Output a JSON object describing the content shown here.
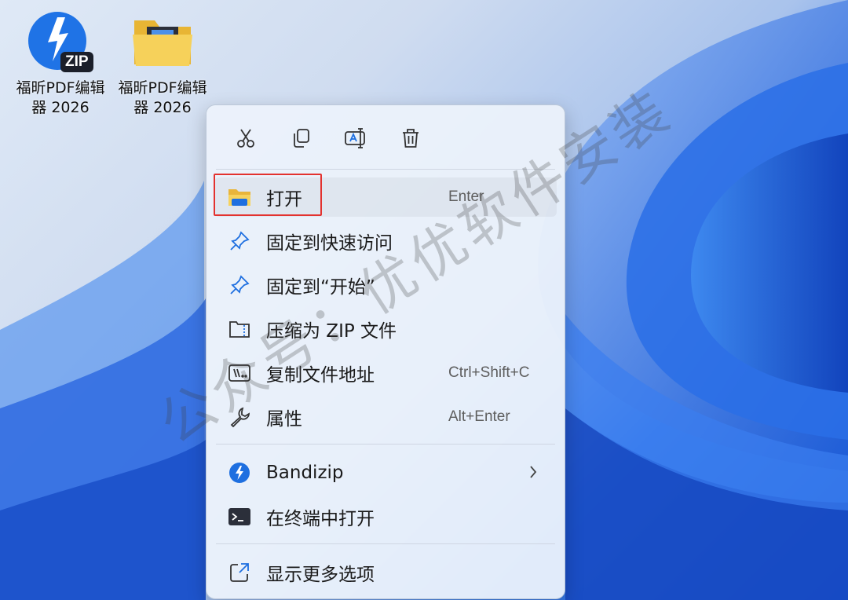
{
  "desktop": {
    "icons": [
      {
        "label_line1": "福昕PDF编辑",
        "label_line2": "器 2026",
        "icon": "zip-archive-icon",
        "badge": "ZIP"
      },
      {
        "label_line1": "福昕PDF编辑",
        "label_line2": "器 2026",
        "icon": "folder-icon"
      }
    ]
  },
  "context_menu": {
    "toolbar": [
      {
        "name": "cut",
        "icon": "scissors-icon"
      },
      {
        "name": "copy",
        "icon": "copy-icon"
      },
      {
        "name": "rename",
        "icon": "rename-icon"
      },
      {
        "name": "delete",
        "icon": "trash-icon"
      }
    ],
    "items": [
      {
        "label": "打开",
        "shortcut": "Enter",
        "icon": "folder-open-icon"
      },
      {
        "label": "固定到快速访问",
        "icon": "pin-icon"
      },
      {
        "label": "固定到“开始”",
        "icon": "pin-icon"
      },
      {
        "label": "压缩为 ZIP 文件",
        "icon": "zip-compress-icon"
      },
      {
        "label": "复制文件地址",
        "shortcut": "Ctrl+Shift+C",
        "icon": "copy-path-icon"
      },
      {
        "label": "属性",
        "shortcut": "Alt+Enter",
        "icon": "wrench-icon"
      },
      {
        "label": "Bandizip",
        "icon": "bandizip-icon",
        "has_submenu": true
      },
      {
        "label": "在终端中打开",
        "icon": "terminal-icon"
      },
      {
        "label": "显示更多选项",
        "icon": "show-more-icon"
      }
    ]
  },
  "watermark": "公众号：优优软件安装",
  "colors": {
    "highlight_border": "#e3322f",
    "accent": "#1e6fe0"
  }
}
